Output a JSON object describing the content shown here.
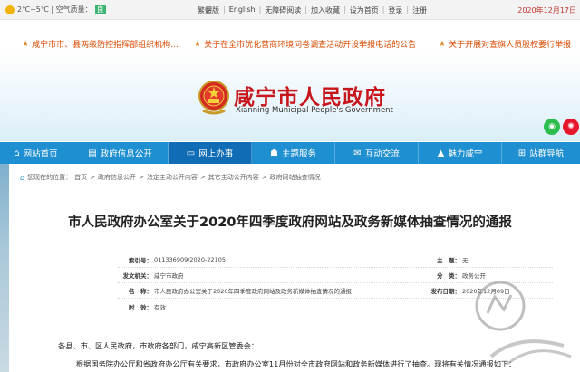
{
  "topbar": {
    "weather_text": "2℃~5℃ | 空气质量：",
    "weather_badge": "良",
    "links": [
      "繁體版",
      "English",
      "无障碍阅读",
      "加入收藏",
      "设为首页",
      "登录",
      "注册"
    ],
    "date": "2020年12月17日"
  },
  "ticker": {
    "items": [
      "咸宁市市、县两级防控指挥部组织机构…",
      "关于在全市优化营商环境问卷调查活动开设举报电话的公告",
      "关于开展对查旗人员股权要行举报"
    ]
  },
  "banner": {
    "title": "咸宁市人民政府",
    "subtitle": "Xianning Municipal People's Government"
  },
  "nav": {
    "items": [
      {
        "label": "网站首页",
        "icon": "home-icon"
      },
      {
        "label": "政府信息公开",
        "icon": "document-icon"
      },
      {
        "label": "网上办事",
        "icon": "monitor-icon"
      },
      {
        "label": "主题服务",
        "icon": "people-icon"
      },
      {
        "label": "互动交流",
        "icon": "chat-icon"
      },
      {
        "label": "魅力咸宁",
        "icon": "mountain-icon"
      },
      {
        "label": "站群导航",
        "icon": "sitemap-icon"
      }
    ],
    "active_index": 2,
    "colors": {
      "bar": "#1e8fd0",
      "active": "#0f6cb5"
    }
  },
  "breadcrumb": {
    "prefix": "您现在的位置：",
    "items": [
      "首页",
      "政府信息公开",
      "法定主动公开内容",
      "其它主动公开内容",
      "政府网站抽查情况"
    ]
  },
  "article": {
    "title": "市人民政府办公室关于2020年四季度政府网站及政务新媒体抽查情况的通报",
    "meta": {
      "index_label": "索引号：",
      "index_value": "011336909/2020-22105",
      "topic_label": "主　题：",
      "topic_value": "无",
      "org_label": "发文机关：",
      "org_value": "咸宁市政府",
      "category_label": "分　类：",
      "category_value": "政务公开",
      "name_label": "名　称：",
      "name_value": "市人民政府办公室关于2020年四季度政府网站及政务新媒体抽查情况的通报",
      "date_label": "发布日期：",
      "date_value": "2020年12月09日",
      "validity_label": "时　效：",
      "validity_value": "有效"
    },
    "para1": "各县、市、区人民政府，市政府各部门，咸宁高新区管委会：",
    "para2": "根据国务院办公厅和省政府办公厅有关要求，市政府办公室11月份对全市政府网站和政务新媒体进行了抽查。现将有关情况通报如下："
  }
}
